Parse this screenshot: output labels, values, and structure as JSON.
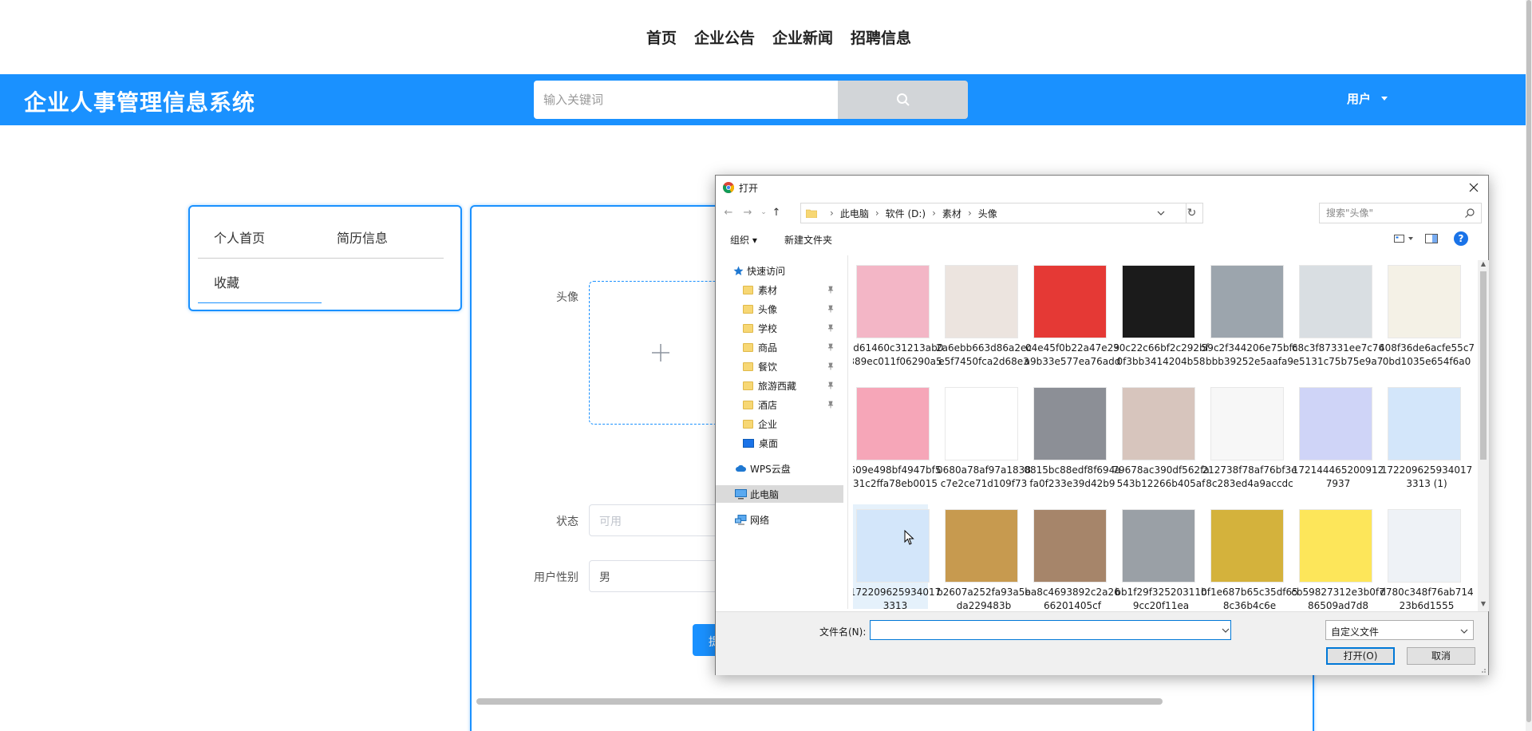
{
  "topnav": {
    "items": [
      "首页",
      "企业公告",
      "企业新闻",
      "招聘信息"
    ]
  },
  "header": {
    "brand": "企业人事管理信息系统",
    "search_placeholder": "输入关键词",
    "user_label": "用户"
  },
  "side_menu": {
    "items": [
      "个人首页",
      "简历信息",
      "收藏"
    ]
  },
  "form": {
    "avatar_label": "头像",
    "status_label": "状态",
    "status_placeholder": "可用",
    "gender_label": "用户性别",
    "gender_value": "男",
    "submit_label": "提"
  },
  "dialog": {
    "title": "打开",
    "breadcrumbs": [
      "此电脑",
      "软件 (D:)",
      "素材",
      "头像"
    ],
    "search_placeholder": "搜索\"头像\"",
    "organize_label": "组织",
    "new_folder_label": "新建文件夹",
    "help_label": "?",
    "tree": {
      "quick_access": "快速访问",
      "pinned": [
        "素材",
        "头像",
        "学校",
        "商品",
        "餐饮",
        "旅游西藏",
        "酒店"
      ],
      "folders": [
        "企业"
      ],
      "desktop": "桌面",
      "wps": "WPS云盘",
      "this_pc": "此电脑",
      "network": "网络"
    },
    "files": [
      {
        "name": "0d61460c31213ab0389ec011f06290a5",
        "color": "#f3b6c6"
      },
      {
        "name": "2a6ebb663d86a2ece5f7450fca2d68e3",
        "color": "#ece4df"
      },
      {
        "name": "04e45f0b22a47e29a9b33e577ea76add",
        "color": "#e53935"
      },
      {
        "name": "30c22c66bf2c292bf0f3bb3414204b58",
        "color": "#1b1b1b"
      },
      {
        "name": "59c2f344206e75bfcbbb39252e5aafa9",
        "color": "#9ca5ad"
      },
      {
        "name": "68c3f87331ee7c76e5131c75b75e9a7",
        "color": "#d9dee2"
      },
      {
        "name": "408f36de6acfe55c70bd1035e654f6a0",
        "color": "#f4f1e6"
      },
      {
        "name": "609e498bf4947bf531c2ffa78eb0015",
        "color": "#f6a6b8"
      },
      {
        "name": "0680a78af97a1838c7e2ce71d109f73",
        "color": "#ffffff"
      },
      {
        "name": "0815bc88edf8f694afa0f233e39d42b9",
        "color": "#8c8f96"
      },
      {
        "name": "79678ac390df562fa543b12266b405af",
        "color": "#d7c5bd"
      },
      {
        "name": "212738f78af76bf3e8c283ed4a9accdc",
        "color": "#f7f7f7"
      },
      {
        "name": "1721444652009127937",
        "color": "#cfd4f7"
      },
      {
        "name": "1722096259340173313 (1)",
        "color": "#d3e6fa"
      },
      {
        "name": "1722096259340173313",
        "color": "#d3e6fa"
      },
      {
        "name": "b2607a252fa93a5eda229483b",
        "color": "#c79a4f"
      },
      {
        "name": "ba8c4693892c2a2666201405cf",
        "color": "#a6856a"
      },
      {
        "name": "bb1f29f3252031109cc20f11ea",
        "color": "#9aa0a6"
      },
      {
        "name": "bf1e687b65c35df658c36b4c6e",
        "color": "#d4b23c"
      },
      {
        "name": "cb59827312e3b0f786509ad7d8",
        "color": "#fde65a"
      },
      {
        "name": "d780c348f76ab71423b6d1555",
        "color": "#eef2f6"
      }
    ],
    "filename_label": "文件名(N):",
    "filename_value": "",
    "filetype_value": "自定义文件",
    "open_label": "打开(O)",
    "cancel_label": "取消"
  },
  "colors": {
    "brand_blue": "#1a91ff",
    "win_blue": "#0078d7"
  }
}
